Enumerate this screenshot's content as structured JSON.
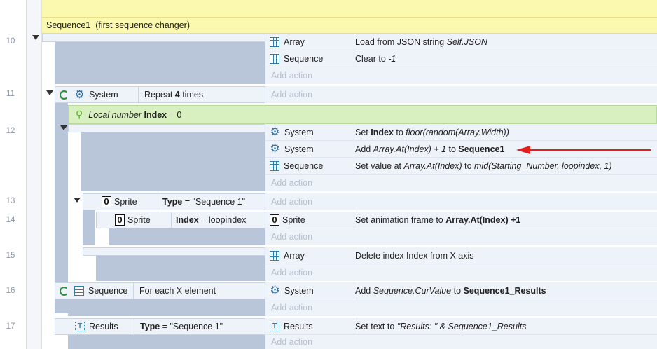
{
  "group": {
    "title": "Sequence1  (first sequence changer)"
  },
  "add_action_label": "Add action",
  "line_numbers": [
    "10",
    "11",
    "12",
    "13",
    "14",
    "15",
    "16",
    "17"
  ],
  "events": {
    "e10": {
      "actions": [
        {
          "object": "Array",
          "icon": "array-icon",
          "text_a": "Load from JSON string ",
          "text_i": "Self.JSON"
        },
        {
          "object": "Sequence",
          "icon": "array-icon",
          "text_a": "Clear to ",
          "text_i": "-1"
        }
      ]
    },
    "e11": {
      "cond_object": "System",
      "cond_a": "Repeat ",
      "cond_b": "4",
      "cond_c": " times"
    },
    "local": {
      "pre": "Local number ",
      "name": "Index",
      "post": " = 0"
    },
    "e12": {
      "a1": {
        "object": "System",
        "t1": "Set ",
        "b1": "Index",
        "t2": " to ",
        "i1": "floor(random(Array.Width))"
      },
      "a2": {
        "object": "System",
        "t1": "Add ",
        "i1": "Array.At(Index) + 1",
        "t2": " to ",
        "b1": "Sequence1"
      },
      "a3": {
        "object": "Sequence",
        "t1": "Set value at ",
        "i1": "Array.At(Index)",
        "t2": " to ",
        "i2": "mid(Starting_Number, loopindex, 1)"
      }
    },
    "e13": {
      "cond_object": "Sprite",
      "cond_b": "Type",
      "cond_c": " = \"Sequence 1\""
    },
    "e14": {
      "cond_object": "Sprite",
      "cond_b": "Index",
      "cond_c": " = loopindex",
      "act_object": "Sprite",
      "act_a": "Set animation frame to ",
      "act_b": "Array.At(Index)",
      "act_c": " +1"
    },
    "e15": {
      "act_object": "Array",
      "act_a": "Delete index Index from X axis"
    },
    "e16": {
      "cond_object": "Sequence",
      "cond_a": "For each X element",
      "act_object": "System",
      "act_t1": "Add ",
      "act_i": "Sequence.CurValue",
      "act_t2": " to ",
      "act_b": "Sequence1_Results"
    },
    "e17": {
      "cond_object": "Results",
      "cond_b": "Type",
      "cond_c": " = \"Sequence 1\"",
      "act_object": "Results",
      "act_t1": "Set text to ",
      "act_q": "\"Results: \"",
      "act_t2": " & ",
      "act_i": "Sequence1_Results"
    }
  },
  "colors": {
    "group_bg": "#fbf8b0",
    "local_bg": "#d8efc0",
    "event_bg": "#b9c6d9",
    "arrow": "#e02020"
  }
}
